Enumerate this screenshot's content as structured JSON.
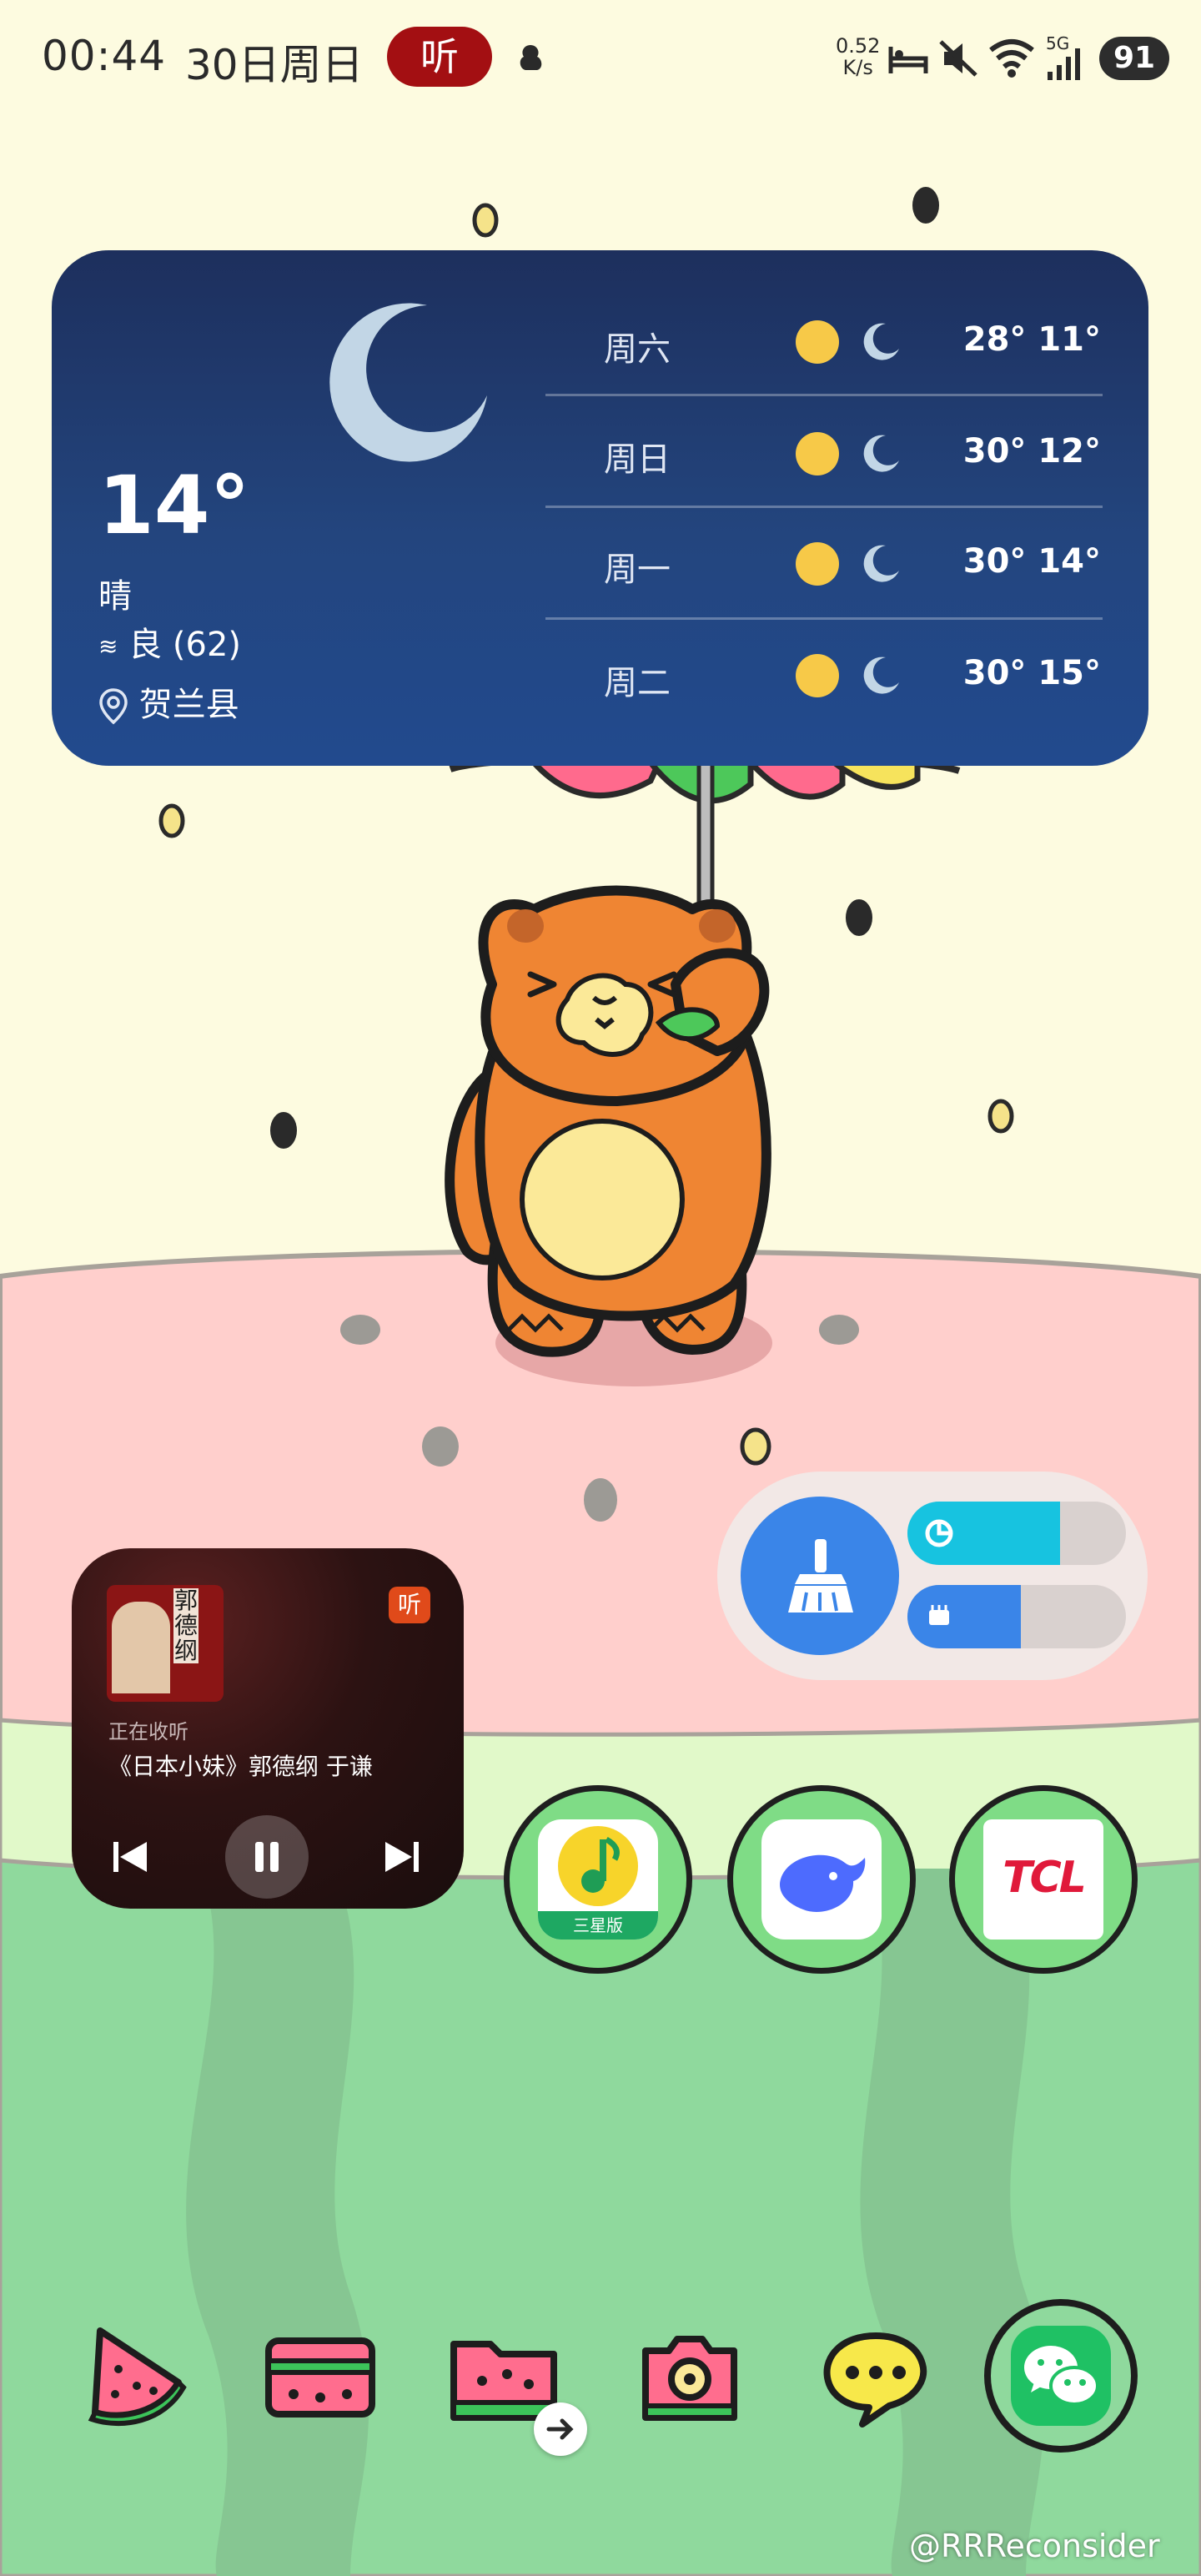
{
  "status_bar": {
    "time": "00:44",
    "date": "30日周日",
    "ting_badge": "听",
    "net_speed_value": "0.52",
    "net_speed_unit": "K/s",
    "network": "5G",
    "battery": "91"
  },
  "weather": {
    "temperature": "14°",
    "condition": "晴",
    "aqi": "良 (62)",
    "location": "贺兰县",
    "forecast": [
      {
        "day": "周六",
        "range": "28° 11°"
      },
      {
        "day": "周日",
        "range": "30° 12°"
      },
      {
        "day": "周一",
        "range": "30° 14°"
      },
      {
        "day": "周二",
        "range": "30° 15°"
      }
    ]
  },
  "music": {
    "app_badge": "听",
    "cover_text": "郭德纲",
    "status": "正在收听",
    "title": "《日本小妹》郭德纲 于谦"
  },
  "cleaner": {
    "storage_level": 0.7,
    "memory_level": 0.52
  },
  "apps": [
    {
      "name": "qq-music",
      "badge": "三星版"
    },
    {
      "name": "deepseek"
    },
    {
      "name": "tcl",
      "text": "TCL"
    }
  ],
  "dock": [
    {
      "name": "watermelon"
    },
    {
      "name": "wallet"
    },
    {
      "name": "files"
    },
    {
      "name": "camera"
    },
    {
      "name": "messages"
    },
    {
      "name": "wechat"
    }
  ],
  "watermark": "@RRReconsider",
  "colors": {
    "sky": "#fdfbe0",
    "pink_ground": "#ffcfcc",
    "light_green": "#e0fac8",
    "grass": "#8fd99d",
    "weather_bg": "#203e78",
    "accent_blue": "#3a85e8",
    "cyan": "#17c3e0"
  }
}
